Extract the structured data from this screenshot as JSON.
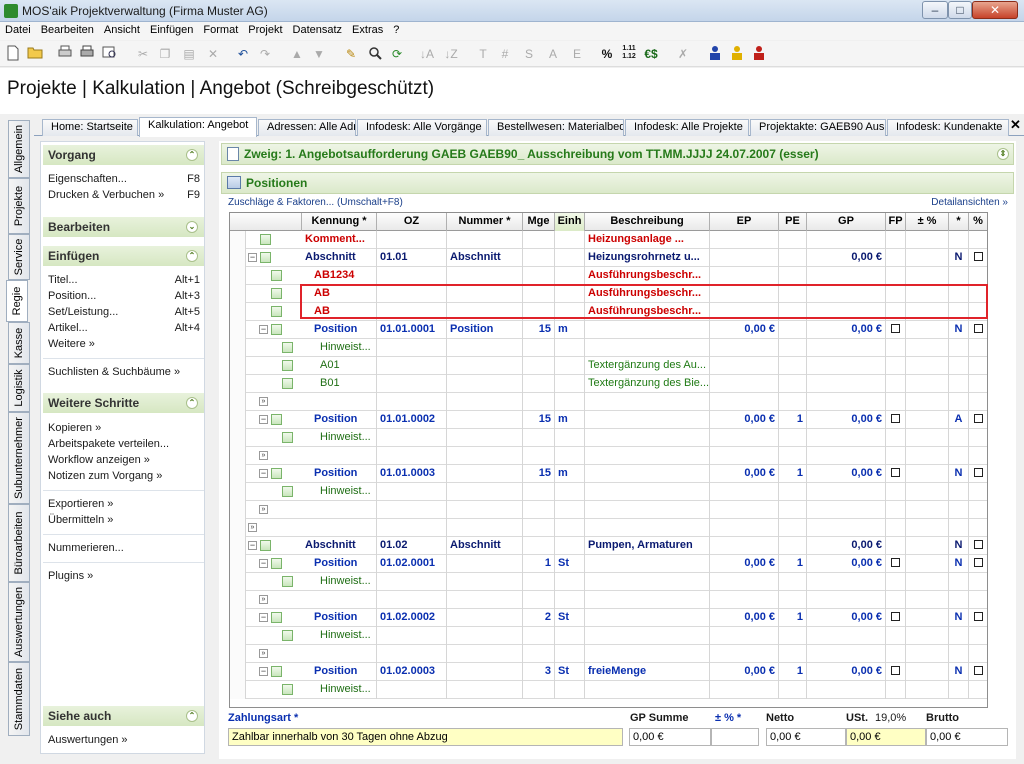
{
  "window": {
    "title": "MOS'aik Projektverwaltung (Firma Muster AG)",
    "min": "–",
    "max": "□",
    "close": "✕"
  },
  "menu": [
    "Datei",
    "Bearbeiten",
    "Ansicht",
    "Einfügen",
    "Format",
    "Projekt",
    "Datensatz",
    "Extras",
    "?"
  ],
  "toolbar": {
    "t1": "T",
    "t2": "#",
    "t3": "S",
    "t4": "A",
    "t5": "E",
    "percent": "%",
    "decimals": "1.11 1.12",
    "currency": "€$"
  },
  "header": {
    "title": "Projekte | Kalkulation | Angebot (Schreibgeschützt)"
  },
  "tabs": [
    "Home: Startseite",
    "Kalkulation: Angebot",
    "Adressen: Alle Adr",
    "Infodesk: Alle Vorgänge",
    "Bestellwesen: Materialbed",
    "Infodesk: Alle Projekte",
    "Projektakte: GAEB90 Aus",
    "Infodesk: Kundenakte"
  ],
  "tab_close": "✕",
  "vtabs": [
    "Allgemein",
    "Projekte",
    "Service",
    "Regie",
    "Kasse",
    "Logistik",
    "Subunternehmer",
    "Büroarbeiten",
    "Auswertungen",
    "Stammdaten"
  ],
  "sidebar": {
    "vorgang": "Vorgang",
    "eigenschaften": "Eigenschaften...",
    "eigenschaften_key": "F8",
    "drucken": "Drucken & Verbuchen »",
    "drucken_key": "F9",
    "bearbeiten": "Bearbeiten",
    "einfuegen": "Einfügen",
    "titel": "Titel...",
    "titel_key": "Alt+1",
    "position": "Position...",
    "position_key": "Alt+3",
    "set": "Set/Leistung...",
    "set_key": "Alt+5",
    "artikel": "Artikel...",
    "artikel_key": "Alt+4",
    "weitere": "Weitere »",
    "suchlisten": "Suchlisten & Suchbäume »",
    "weitere_schritte": "Weitere Schritte",
    "kopieren": "Kopieren »",
    "arbeitspakete": "Arbeitspakete verteilen...",
    "workflow": "Workflow anzeigen »",
    "notizen": "Notizen zum Vorgang »",
    "exportieren": "Exportieren »",
    "uebermitteln": "Übermitteln »",
    "nummerieren": "Nummerieren...",
    "plugins": "Plugins »",
    "siehe_auch": "Siehe auch",
    "auswertungen": "Auswertungen »"
  },
  "main": {
    "zweig": "Zweig: 1. Angebotsaufforderung GAEB GAEB90_ Ausschreibung vom TT.MM.JJJJ 24.07.2007 (esser)",
    "positionen": "Positionen",
    "zuschlag": "Zuschläge & Faktoren... (Umschalt+F8)",
    "detail": "Detailansichten »"
  },
  "columns": [
    "Kennung *",
    "OZ",
    "Nummer *",
    "Mge",
    "Einh",
    "Beschreibung",
    "EP",
    "PE",
    "GP",
    "FP",
    "± %",
    "*",
    "%"
  ],
  "rows": [
    {
      "kennung": "Komment...",
      "kcls": "red",
      "beschr": "Heizungsanlage ...",
      "bcls": "red"
    },
    {
      "kennung": "Abschnitt",
      "kcls": "navy",
      "oz": "01.01",
      "nummer": "Abschnitt",
      "beschr": "Heizungsrohrnetz u...",
      "bcls": "navy",
      "gp": "0,00 €",
      "star": "N",
      "pct": "box"
    },
    {
      "kennung": "AB1234",
      "kcls": "red",
      "beschr": "Ausführungsbeschr...",
      "bcls": "red"
    },
    {
      "kennung": "AB",
      "kcls": "red",
      "beschr": "Ausführungsbeschr...",
      "bcls": "red"
    },
    {
      "kennung": "AB",
      "kcls": "red",
      "beschr": "Ausführungsbeschr...",
      "bcls": "red"
    },
    {
      "kennung": "Position",
      "kcls": "blue",
      "oz": "01.01.0001",
      "nummer": "Position",
      "mge": "15",
      "einh": "m",
      "ep": "0,00 €",
      "gp": "0,00 €",
      "fp": "box",
      "star": "N",
      "pct": "box"
    },
    {
      "kennung": "Hinweist...",
      "kcls": "green"
    },
    {
      "kennung": "A01",
      "kcls": "green",
      "beschr": "Textergänzung des Au...",
      "bcls": "green"
    },
    {
      "kennung": "B01",
      "kcls": "green",
      "beschr": "Textergänzung des Bie...",
      "bcls": "green"
    },
    {},
    {
      "kennung": "Position",
      "kcls": "blue",
      "oz": "01.01.0002",
      "mge": "15",
      "einh": "m",
      "ep": "0,00 €",
      "pe": "1",
      "gp": "0,00 €",
      "fp": "box",
      "star": "A",
      "pct": "box"
    },
    {
      "kennung": "Hinweist...",
      "kcls": "green"
    },
    {},
    {
      "kennung": "Position",
      "kcls": "blue",
      "oz": "01.01.0003",
      "mge": "15",
      "einh": "m",
      "ep": "0,00 €",
      "pe": "1",
      "gp": "0,00 €",
      "fp": "box",
      "star": "N",
      "pct": "box"
    },
    {
      "kennung": "Hinweist...",
      "kcls": "green"
    },
    {},
    {},
    {
      "kennung": "Abschnitt",
      "kcls": "navy",
      "oz": "01.02",
      "nummer": "Abschnitt",
      "beschr": "Pumpen, Armaturen",
      "bcls": "navy",
      "gp": "0,00 €",
      "star": "N",
      "pct": "box"
    },
    {
      "kennung": "Position",
      "kcls": "blue",
      "oz": "01.02.0001",
      "mge": "1",
      "einh": "St",
      "ep": "0,00 €",
      "pe": "1",
      "gp": "0,00 €",
      "fp": "box",
      "star": "N",
      "pct": "box"
    },
    {
      "kennung": "Hinweist...",
      "kcls": "green"
    },
    {},
    {
      "kennung": "Position",
      "kcls": "blue",
      "oz": "01.02.0002",
      "mge": "2",
      "einh": "St",
      "ep": "0,00 €",
      "pe": "1",
      "gp": "0,00 €",
      "fp": "box",
      "star": "N",
      "pct": "box"
    },
    {
      "kennung": "Hinweist...",
      "kcls": "green"
    },
    {},
    {
      "kennung": "Position",
      "kcls": "blue",
      "oz": "01.02.0003",
      "mge": "3",
      "einh": "St",
      "beschr": "freieMenge",
      "bcls": "blue",
      "ep": "0,00 €",
      "pe": "1",
      "gp": "0,00 €",
      "fp": "box",
      "star": "N",
      "pct": "box"
    },
    {
      "kennung": "Hinweist...",
      "kcls": "green"
    }
  ],
  "footer": {
    "zahlungsart_label": "Zahlungsart *",
    "zahlungsart_value": "Zahlbar innerhalb von 30 Tagen ohne Abzug",
    "gp_summe_label": "GP Summe",
    "pm_label": "± % *",
    "netto_label": "Netto",
    "ust_label": "USt.",
    "ust_rate": "19,0%",
    "brutto_label": "Brutto",
    "gp_summe": "0,00 €",
    "pm": "",
    "netto": "0,00 €",
    "ust": "0,00 €",
    "brutto": "0,00 €"
  }
}
